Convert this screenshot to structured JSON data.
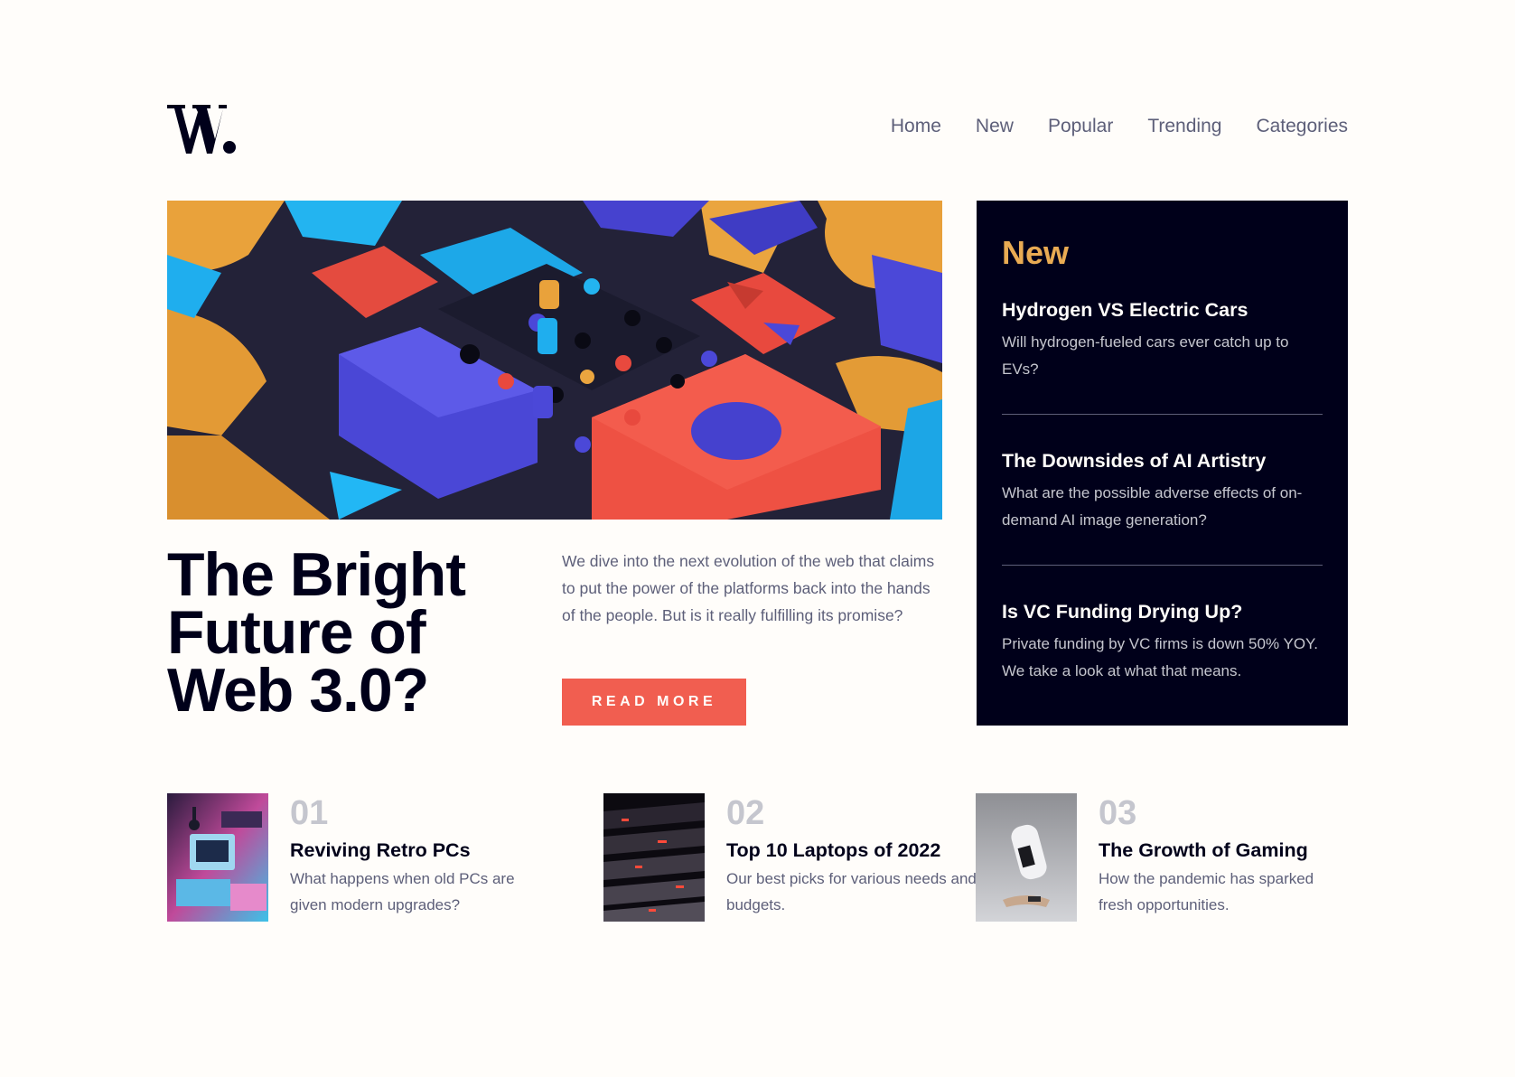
{
  "header": {
    "logo_alt": "W.",
    "nav": [
      "Home",
      "New",
      "Popular",
      "Trending",
      "Categories"
    ]
  },
  "hero": {
    "headline": "The Bright Future of Web 3.0?",
    "description": "We dive into the next evolution of the web that claims to put the power of the platforms back into the hands of the people. But is it really fulfilling its promise?",
    "button_label": "READ MORE"
  },
  "new_panel": {
    "title": "New",
    "items": [
      {
        "title": "Hydrogen VS Electric Cars",
        "text": "Will hydrogen-fueled cars ever catch up to EVs?"
      },
      {
        "title": "The Downsides of AI Artistry",
        "text": "What are the possible adverse effects of on-demand AI image generation?"
      },
      {
        "title": "Is VC Funding Drying Up?",
        "text": "Private funding by VC firms is down 50% YOY. We take a look at what that means."
      }
    ]
  },
  "cards": [
    {
      "num": "01",
      "title": "Reviving Retro PCs",
      "text": "What happens when old PCs are given modern upgrades?"
    },
    {
      "num": "02",
      "title": "Top 10 Laptops of 2022",
      "text": "Our best picks for various needs and budgets."
    },
    {
      "num": "03",
      "title": "The Growth of Gaming",
      "text": "How the pandemic has sparked fresh opportunities."
    }
  ],
  "colors": {
    "background": "#FFFDFA",
    "dark": "#00001A",
    "accent_red": "#F15E50",
    "accent_orange": "#E9AB53",
    "grayish_blue": "#5D5F79",
    "light_gray": "#C5C6CE"
  }
}
